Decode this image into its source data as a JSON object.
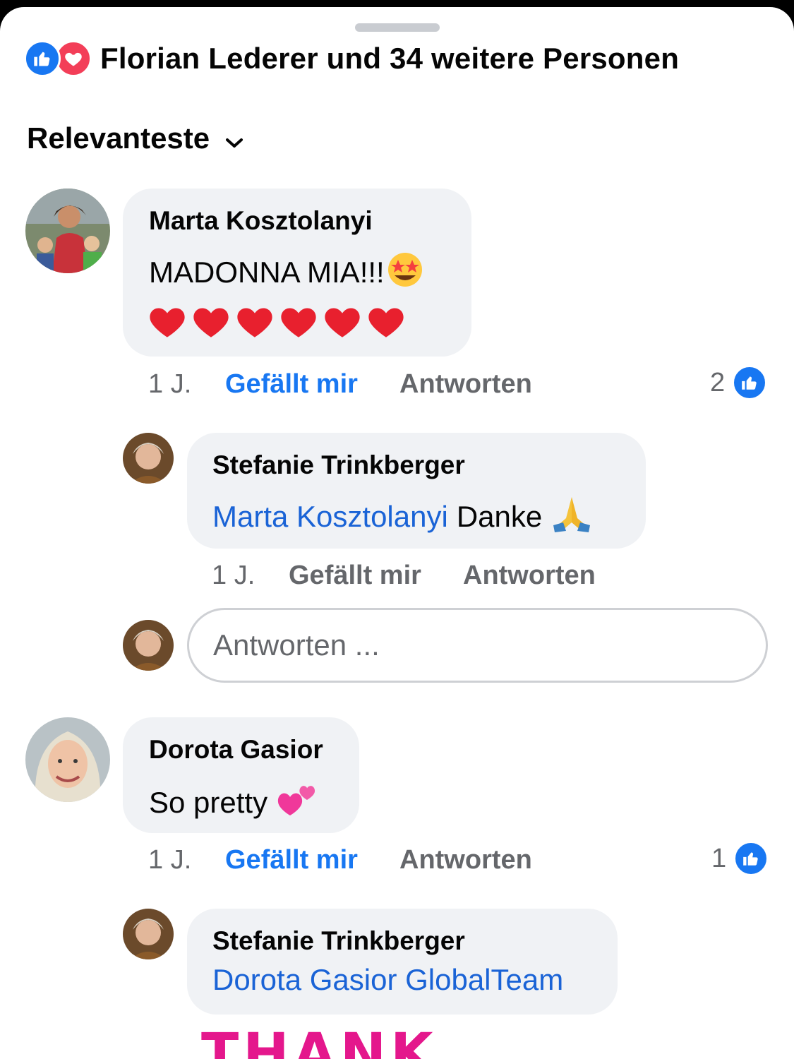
{
  "header": {
    "reactions_text": "Florian Lederer und 34 weitere Personen",
    "reaction_icons": [
      "like-icon",
      "love-icon"
    ]
  },
  "sort": {
    "label": "Relevanteste"
  },
  "comments": [
    {
      "author": "Marta Kosztolanyi",
      "text": "MADONNA MIA!!!",
      "emoji_line": "❤️❤️❤️❤️❤️❤️",
      "time": "1 J.",
      "like_label": "Gefällt mir",
      "reply_label": "Antworten",
      "like_count": "2"
    },
    {
      "author": "Stefanie Trinkberger",
      "mention": "Marta Kosztolanyi",
      "text": "Danke",
      "time": "1 J.",
      "like_label": "Gefällt mir",
      "reply_label": "Antworten"
    },
    {
      "author": "Dorota Gasior",
      "text": "So pretty",
      "time": "1 J.",
      "like_label": "Gefällt mir",
      "reply_label": "Antworten",
      "like_count": "1"
    },
    {
      "author": "Stefanie Trinkberger",
      "mention": "Dorota Gasior GlobalTeam",
      "image_text": "THANK"
    }
  ],
  "reply_box": {
    "placeholder": "Antworten ..."
  },
  "colors": {
    "accent": "#1877f2",
    "love": "#f33e58",
    "bubble": "#f0f2f5",
    "muted": "#65676b"
  }
}
